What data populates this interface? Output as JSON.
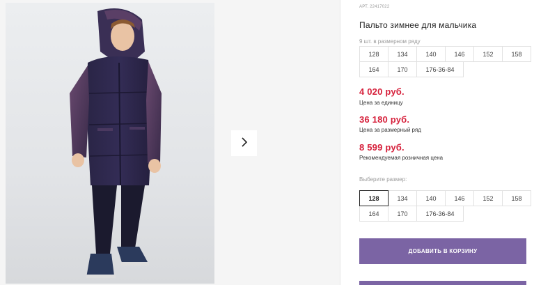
{
  "product": {
    "sku": "АРТ. 22417022",
    "title": "Пальто зимнее для мальчика",
    "row_note": "9 шт. в размерном ряду"
  },
  "size_row": {
    "row1": [
      "128",
      "134",
      "140",
      "146",
      "152",
      "158"
    ],
    "row2": [
      "164",
      "170",
      "176-36-84"
    ]
  },
  "prices": {
    "unit": {
      "value": "4 020 руб.",
      "label": "Цена за единицу"
    },
    "row": {
      "value": "36 180 руб.",
      "label": "Цена за размерный ряд"
    },
    "retail": {
      "value": "8 599 руб.",
      "label": "Рекомендуемая розничная цена"
    }
  },
  "size_select": {
    "label": "Выберите размер:",
    "selected": "128",
    "row1": [
      "128",
      "134",
      "140",
      "146",
      "152",
      "158"
    ],
    "row2": [
      "164",
      "170",
      "176-36-84"
    ]
  },
  "actions": {
    "add_to_cart": "ДОБАВИТЬ В КОРЗИНУ"
  },
  "icons": {
    "next": "chevron-right-icon"
  },
  "colors": {
    "price": "#d6203b",
    "button": "#7b64a4"
  }
}
